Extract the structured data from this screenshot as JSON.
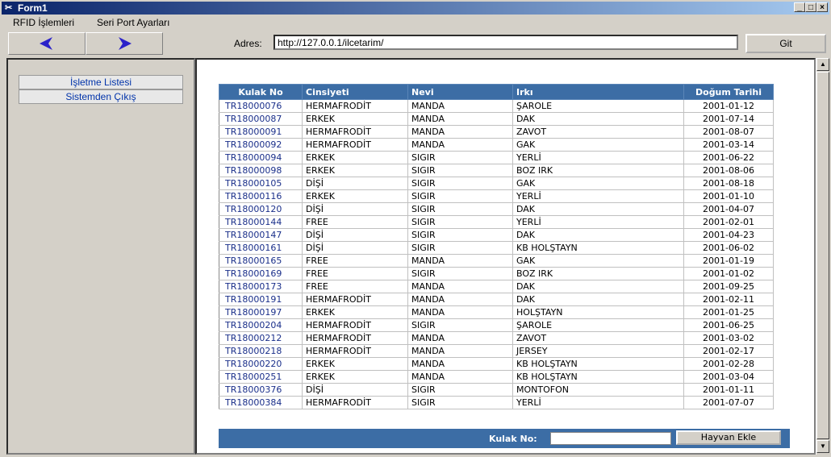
{
  "window": {
    "title": "Form1",
    "icon": "app-icon",
    "buttons": [
      "minimize-icon",
      "maximize-icon",
      "close-icon"
    ]
  },
  "menu": [
    "RFID İşlemleri",
    "Seri Port Ayarları"
  ],
  "nav": {
    "back_icon": "back-arrow-icon",
    "forward_icon": "forward-arrow-icon",
    "address_label": "Adres:",
    "address_value": "http://127.0.0.1/ilcetarim/",
    "go_label": "Git",
    "accent": "#2b22c9"
  },
  "sidebar": {
    "items": [
      {
        "label": "İşletme Listesi"
      },
      {
        "label": "Sistemden Çıkış"
      }
    ]
  },
  "table": {
    "headers": [
      "Kulak No",
      "Cinsiyeti",
      "Nevi",
      "Irkı",
      "Doğum Tarihi"
    ],
    "header_color": "#3c6da5",
    "rows": [
      [
        "TR18000076",
        "HERMAFRODİT",
        "MANDA",
        "ŞAROLE",
        "2001-01-12"
      ],
      [
        "TR18000087",
        "ERKEK",
        "MANDA",
        "DAK",
        "2001-07-14"
      ],
      [
        "TR18000091",
        "HERMAFRODİT",
        "MANDA",
        "ZAVOT",
        "2001-08-07"
      ],
      [
        "TR18000092",
        "HERMAFRODİT",
        "MANDA",
        "GAK",
        "2001-03-14"
      ],
      [
        "TR18000094",
        "ERKEK",
        "SIGIR",
        "YERLİ",
        "2001-06-22"
      ],
      [
        "TR18000098",
        "ERKEK",
        "SIGIR",
        "BOZ IRK",
        "2001-08-06"
      ],
      [
        "TR18000105",
        "DİŞİ",
        "SIGIR",
        "GAK",
        "2001-08-18"
      ],
      [
        "TR18000116",
        "ERKEK",
        "SIGIR",
        "YERLİ",
        "2001-01-10"
      ],
      [
        "TR18000120",
        "DİŞİ",
        "SIGIR",
        "DAK",
        "2001-04-07"
      ],
      [
        "TR18000144",
        "FREE",
        "SIGIR",
        "YERLİ",
        "2001-02-01"
      ],
      [
        "TR18000147",
        "DİŞİ",
        "SIGIR",
        "DAK",
        "2001-04-23"
      ],
      [
        "TR18000161",
        "DİŞİ",
        "SIGIR",
        "KB HOLŞTAYN",
        "2001-06-02"
      ],
      [
        "TR18000165",
        "FREE",
        "MANDA",
        "GAK",
        "2001-01-19"
      ],
      [
        "TR18000169",
        "FREE",
        "SIGIR",
        "BOZ IRK",
        "2001-01-02"
      ],
      [
        "TR18000173",
        "FREE",
        "MANDA",
        "DAK",
        "2001-09-25"
      ],
      [
        "TR18000191",
        "HERMAFRODİT",
        "MANDA",
        "DAK",
        "2001-02-11"
      ],
      [
        "TR18000197",
        "ERKEK",
        "MANDA",
        "HOLŞTAYN",
        "2001-01-25"
      ],
      [
        "TR18000204",
        "HERMAFRODİT",
        "SIGIR",
        "ŞAROLE",
        "2001-06-25"
      ],
      [
        "TR18000212",
        "HERMAFRODİT",
        "MANDA",
        "ZAVOT",
        "2001-03-02"
      ],
      [
        "TR18000218",
        "HERMAFRODİT",
        "MANDA",
        "JERSEY",
        "2001-02-17"
      ],
      [
        "TR18000220",
        "ERKEK",
        "MANDA",
        "KB HOLŞTAYN",
        "2001-02-28"
      ],
      [
        "TR18000251",
        "ERKEK",
        "MANDA",
        "KB HOLŞTAYN",
        "2001-03-04"
      ],
      [
        "TR18000376",
        "DİŞİ",
        "SIGIR",
        "MONTOFON",
        "2001-01-11"
      ],
      [
        "TR18000384",
        "HERMAFRODİT",
        "SIGIR",
        "YERLİ",
        "2001-07-07"
      ]
    ]
  },
  "footer": {
    "label": "Kulak No:",
    "input_value": "",
    "button_label": "Hayvan Ekle"
  }
}
